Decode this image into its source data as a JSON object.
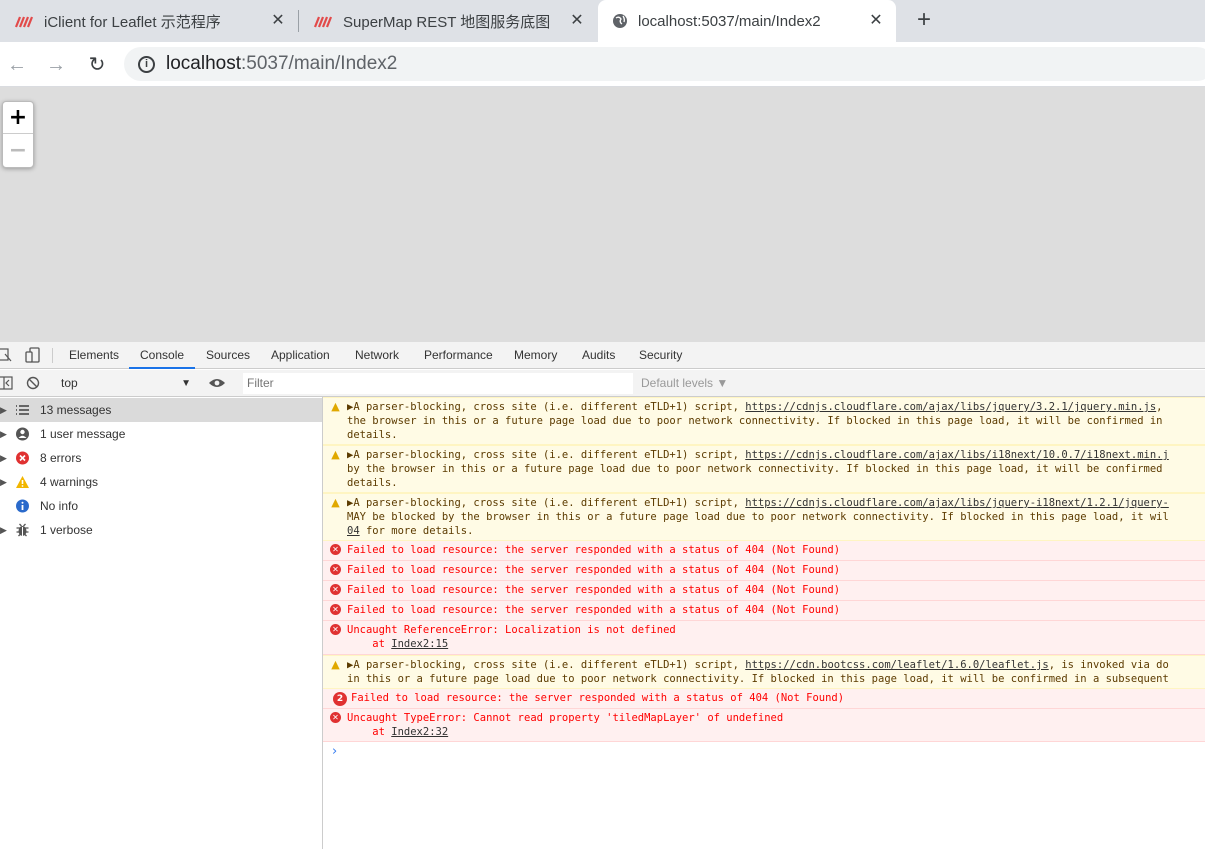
{
  "browser": {
    "tabs": [
      {
        "title": "iClient for Leaflet 示范程序",
        "active": false
      },
      {
        "title": "SuperMap REST 地图服务底图",
        "active": false
      },
      {
        "title": "localhost:5037/main/Index2",
        "active": true
      }
    ],
    "new_tab": "+",
    "url_host": "localhost",
    "url_rest": ":5037/main/Index2",
    "info_glyph": "i"
  },
  "map": {
    "zoom_in": "+",
    "zoom_out": "−"
  },
  "devtools": {
    "tabs": [
      "Elements",
      "Console",
      "Sources",
      "Application",
      "Network",
      "Performance",
      "Memory",
      "Audits",
      "Security"
    ],
    "active_tab": "Console",
    "context": "top",
    "filter_placeholder": "Filter",
    "levels": "Default levels ▼",
    "sidebar": [
      {
        "label": "13 messages",
        "icon": "list-icon",
        "selected": true
      },
      {
        "label": "1 user message",
        "icon": "user-icon",
        "selected": false
      },
      {
        "label": "8 errors",
        "icon": "error-icon",
        "selected": false
      },
      {
        "label": "4 warnings",
        "icon": "warning-icon",
        "selected": false
      },
      {
        "label": "No info",
        "icon": "info-icon",
        "selected": false
      },
      {
        "label": "1 verbose",
        "icon": "bug-icon",
        "selected": false
      }
    ],
    "messages": [
      {
        "level": "warn",
        "lines": [
          "▶A parser-blocking, cross site (i.e. different eTLD+1) script, ",
          "the browser in this or a future page load due to poor network connectivity. If blocked in this page load, it will be confirmed in",
          "details."
        ],
        "link": "https://cdnjs.cloudflare.com/ajax/libs/jquery/3.2.1/jquery.min.js",
        "after_link": ","
      },
      {
        "level": "warn",
        "lines": [
          "▶A parser-blocking, cross site (i.e. different eTLD+1) script, ",
          "by the browser in this or a future page load due to poor network connectivity. If blocked in this page load, it will be confirmed",
          "details."
        ],
        "link": "https://cdnjs.cloudflare.com/ajax/libs/i18next/10.0.7/i18next.min.j",
        "after_link": ""
      },
      {
        "level": "warn",
        "lines": [
          "▶A parser-blocking, cross site (i.e. different eTLD+1) script, ",
          "MAY be blocked by the browser in this or a future page load due to poor network connectivity. If blocked in this page load, it wil",
          " for more details."
        ],
        "link": "https://cdnjs.cloudflare.com/ajax/libs/jquery-i18next/1.2.1/jquery-",
        "after_link": "",
        "line3_link": "04"
      },
      {
        "level": "err",
        "lines": [
          "Failed to load resource: the server responded with a status of 404 (Not Found)"
        ]
      },
      {
        "level": "err",
        "lines": [
          "Failed to load resource: the server responded with a status of 404 (Not Found)"
        ]
      },
      {
        "level": "err",
        "lines": [
          "Failed to load resource: the server responded with a status of 404 (Not Found)"
        ]
      },
      {
        "level": "err",
        "lines": [
          "Failed to load resource: the server responded with a status of 404 (Not Found)"
        ]
      },
      {
        "level": "err",
        "lines": [
          "Uncaught ReferenceError: Localization is not defined",
          "    at "
        ],
        "line2_link": "Index2:15"
      },
      {
        "level": "warn",
        "lines": [
          "▶A parser-blocking, cross site (i.e. different eTLD+1) script, ",
          "in this or a future page load due to poor network connectivity. If blocked in this page load, it will be confirmed in a subsequent"
        ],
        "link": "https://cdn.bootcss.com/leaflet/1.6.0/leaflet.js",
        "after_link": ", is invoked via do"
      },
      {
        "level": "err",
        "badge": "2",
        "lines": [
          "Failed to load resource: the server responded with a status of 404 (Not Found)"
        ]
      },
      {
        "level": "err",
        "lines": [
          "Uncaught TypeError: Cannot read property 'tiledMapLayer' of undefined",
          "    at "
        ],
        "line2_link": "Index2:32"
      }
    ],
    "prompt": "›"
  }
}
